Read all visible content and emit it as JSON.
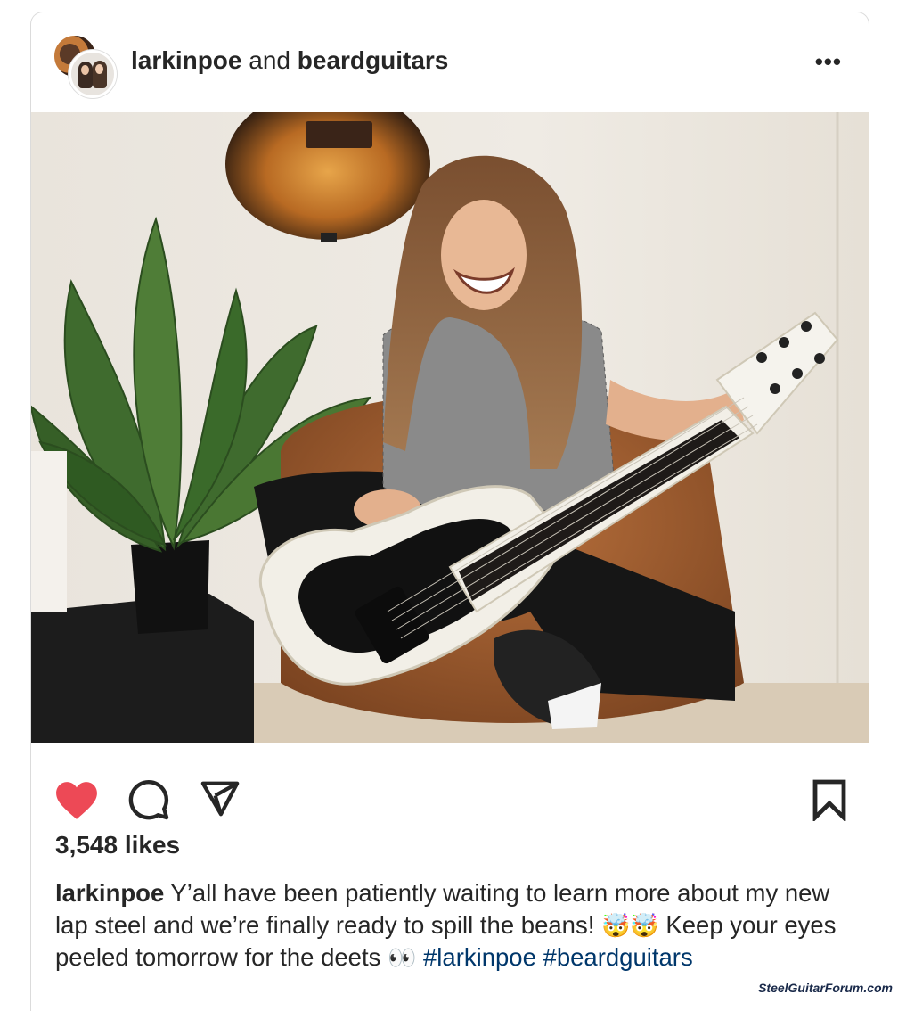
{
  "header": {
    "account_primary": "larkinpoe",
    "joiner": "and",
    "account_collab": "beardguitars",
    "more_label": "•••"
  },
  "actions": {
    "like_icon": "heart-filled-icon",
    "comment_icon": "comment-bubble-icon",
    "share_icon": "paper-plane-icon",
    "save_icon": "bookmark-icon",
    "like_color": "#ed4956"
  },
  "likes": {
    "text": "3,548 likes"
  },
  "caption": {
    "username": "larkinpoe",
    "text_part1": "Y’all have been patiently waiting to learn more about my new lap steel and we’re finally ready to spill the beans!",
    "emoji_mind_blown": "🤯🤯",
    "text_part2": "Keep your eyes peeled tomorrow for the deets",
    "emoji_eyes": "👀",
    "hashtag1": "#larkinpoe",
    "hashtag2": "#beardguitars"
  },
  "watermark": {
    "text": "SteelGuitarForum.com"
  }
}
